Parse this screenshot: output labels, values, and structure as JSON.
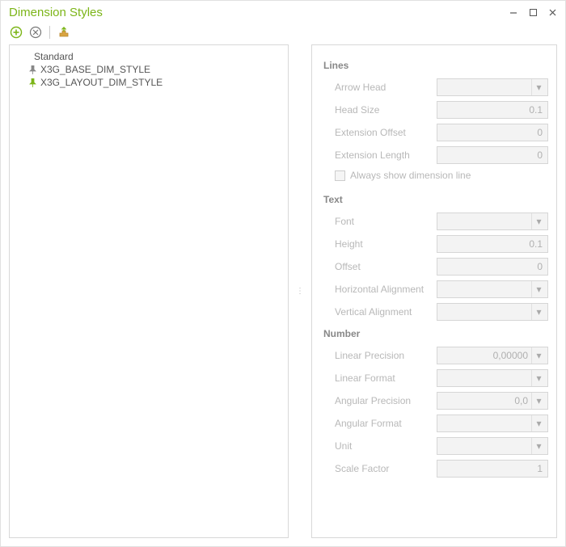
{
  "title": "Dimension Styles",
  "tree": {
    "root": "Standard",
    "items": [
      {
        "label": "X3G_BASE_DIM_STYLE",
        "pin": "gray"
      },
      {
        "label": "X3G_LAYOUT_DIM_STYLE",
        "pin": "green"
      }
    ]
  },
  "sections": {
    "lines": {
      "title": "Lines",
      "arrow_head": {
        "label": "Arrow Head",
        "value": ""
      },
      "head_size": {
        "label": "Head Size",
        "value": "0.1"
      },
      "extension_offset": {
        "label": "Extension Offset",
        "value": "0"
      },
      "extension_length": {
        "label": "Extension Length",
        "value": "0"
      },
      "always_show": {
        "label": "Always show dimension line"
      }
    },
    "text": {
      "title": "Text",
      "font": {
        "label": "Font",
        "value": ""
      },
      "height": {
        "label": "Height",
        "value": "0.1"
      },
      "offset": {
        "label": "Offset",
        "value": "0"
      },
      "h_align": {
        "label": "Horizontal Alignment",
        "value": ""
      },
      "v_align": {
        "label": "Vertical Alignment",
        "value": ""
      }
    },
    "number": {
      "title": "Number",
      "linear_precision": {
        "label": "Linear Precision",
        "value": "0,00000"
      },
      "linear_format": {
        "label": "Linear Format",
        "value": ""
      },
      "angular_precision": {
        "label": "Angular Precision",
        "value": "0,0"
      },
      "angular_format": {
        "label": "Angular Format",
        "value": ""
      },
      "unit": {
        "label": "Unit",
        "value": ""
      },
      "scale_factor": {
        "label": "Scale Factor",
        "value": "1"
      }
    }
  }
}
